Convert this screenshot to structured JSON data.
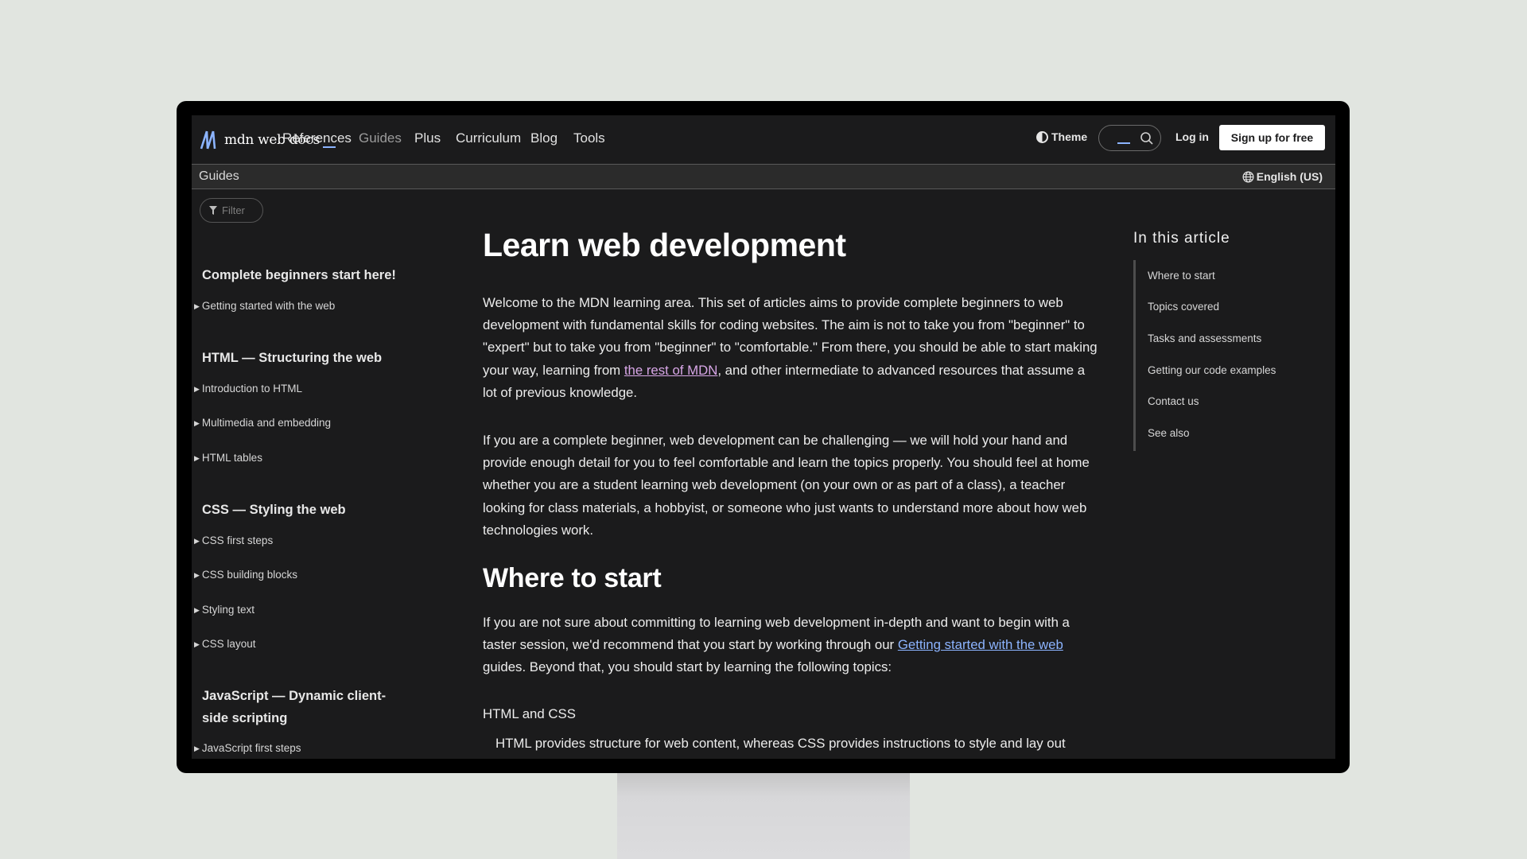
{
  "header": {
    "logo_text": "mdn web docs",
    "nav": [
      {
        "label": "References",
        "active": false
      },
      {
        "label": "Guides",
        "active": true
      },
      {
        "label": "Plus",
        "active": false
      },
      {
        "label": "Curriculum",
        "active": false
      },
      {
        "label": "Blog",
        "active": false
      },
      {
        "label": "Tools",
        "active": false
      }
    ],
    "theme_label": "Theme",
    "search_value": "",
    "login_label": "Log in",
    "signup_label": "Sign up for free"
  },
  "subheader": {
    "title": "Guides",
    "language": "English (US)"
  },
  "sidebar": {
    "filter_placeholder": "Filter",
    "sections": [
      {
        "heading": "Complete beginners start here!",
        "items": [
          "Getting started with the web"
        ]
      },
      {
        "heading": "HTML — Structuring the web",
        "items": [
          "Introduction to HTML",
          "Multimedia and embedding",
          "HTML tables"
        ]
      },
      {
        "heading": "CSS — Styling the web",
        "items": [
          "CSS first steps",
          "CSS building blocks",
          "Styling text",
          "CSS layout"
        ]
      },
      {
        "heading": "JavaScript — Dynamic client-side scripting",
        "items": [
          "JavaScript first steps"
        ]
      }
    ]
  },
  "article": {
    "title": "Learn web development",
    "p1_before": "Welcome to the MDN learning area. This set of articles aims to provide complete beginners to web development with fundamental skills for coding websites. The aim is not to take you from \"beginner\" to \"expert\" but to take you from \"beginner\" to \"comfortable.\" From there, you should be able to start making your way, learning from ",
    "p1_link": "the rest of MDN",
    "p1_after": ", and other intermediate to advanced resources that assume a lot of previous knowledge.",
    "p2": "If you are a complete beginner, web development can be challenging — we will hold your hand and provide enough detail for you to feel comfortable and learn the topics properly. You should feel at home whether you are a student learning web development (on your own or as part of a class), a teacher looking for class materials, a hobbyist, or someone who just wants to understand more about how web technologies work.",
    "h2": "Where to start",
    "p3_before": "If you are not sure about committing to learning web development in-depth and want to begin with a taster session, we'd recommend that you start by working through our ",
    "p3_link": "Getting started with the web",
    "p3_after": " guides. Beyond that, you should start by learning the following topics:",
    "dt": "HTML and CSS",
    "dd": "HTML provides structure for web content, whereas CSS provides instructions to style and lay out"
  },
  "toc": {
    "heading": "In this article",
    "items": [
      "Where to start",
      "Topics covered",
      "Tasks and assessments",
      "Getting our code examples",
      "Contact us",
      "See also"
    ]
  },
  "colors": {
    "accent_blue": "#8cb4ff",
    "visited_link": "#d7a6e6",
    "page_bg": "#1b1b1c",
    "backdrop": "#e1e5e0"
  }
}
